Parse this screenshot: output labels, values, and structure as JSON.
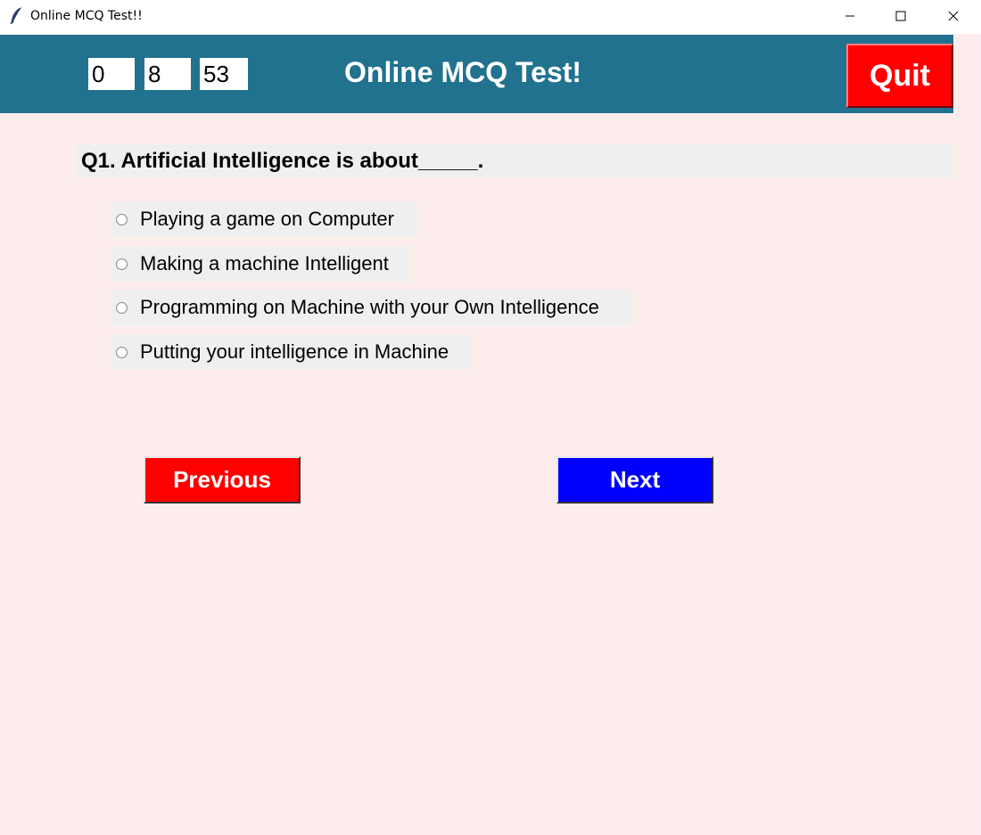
{
  "window": {
    "title": "Online MCQ Test!!",
    "controls": {
      "minimize": "minimize-icon",
      "maximize": "maximize-icon",
      "close": "close-icon"
    }
  },
  "timer": {
    "hours": "0",
    "minutes": "8",
    "seconds": "53"
  },
  "header": {
    "title": "Online MCQ Test!",
    "quit_label": "Quit",
    "background": "#21728f",
    "quit_color": "#ff0000"
  },
  "question": {
    "text": "Q1. Artificial Intelligence is about_____.",
    "options": [
      {
        "label": "Playing a game on Computer",
        "selected": false
      },
      {
        "label": "Making a machine Intelligent",
        "selected": false
      },
      {
        "label": "Programming on Machine with your Own Intelligence",
        "selected": false
      },
      {
        "label": "Putting your intelligence in Machine",
        "selected": false
      }
    ]
  },
  "navigation": {
    "previous_label": "Previous",
    "next_label": "Next",
    "previous_color": "#ff0000",
    "next_color": "#0000ff"
  },
  "colors": {
    "page_background": "#fdecec",
    "panel_background": "#efefef"
  }
}
